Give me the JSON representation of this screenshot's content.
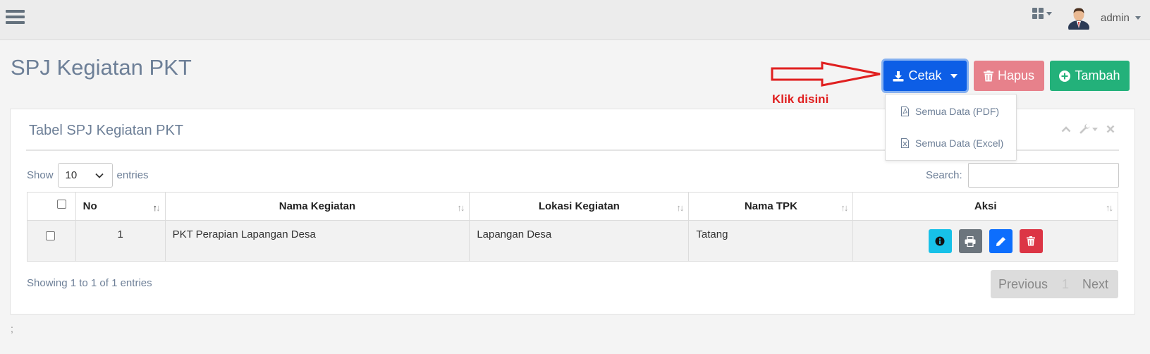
{
  "topbar": {
    "user_name": "admin"
  },
  "page": {
    "title": "SPJ Kegiatan PKT"
  },
  "actions": {
    "cetak_label": "Cetak",
    "hapus_label": "Hapus",
    "tambah_label": "Tambah",
    "annotation": "Klik disini"
  },
  "dropdown": {
    "items": [
      {
        "label": "Semua Data (PDF)",
        "icon": "file-pdf-icon"
      },
      {
        "label": "Semua Data (Excel)",
        "icon": "file-excel-icon"
      }
    ]
  },
  "panel": {
    "title": "Tabel SPJ Kegiatan PKT",
    "show_label": "Show",
    "entries_value": "10",
    "entries_label": "entries",
    "search_label": "Search:",
    "search_value": ""
  },
  "table": {
    "headers": [
      "No",
      "Nama Kegiatan",
      "Lokasi Kegiatan",
      "Nama TPK",
      "Aksi"
    ],
    "rows": [
      {
        "no": "1",
        "nama_kegiatan": "PKT Perapian Lapangan Desa",
        "lokasi": "Lapangan Desa",
        "tpk": "Tatang"
      }
    ]
  },
  "footer": {
    "info": "Showing 1 to 1 of 1 entries",
    "prev": "Previous",
    "page": "1",
    "next": "Next",
    "semicolon": ";"
  },
  "colors": {
    "primary": "#0d5ee6",
    "danger_light": "#e7818b",
    "success": "#23b17a",
    "info": "#17c1e8",
    "secondary": "#6c757d",
    "danger": "#dc3545",
    "annotation_red": "#e02020"
  }
}
